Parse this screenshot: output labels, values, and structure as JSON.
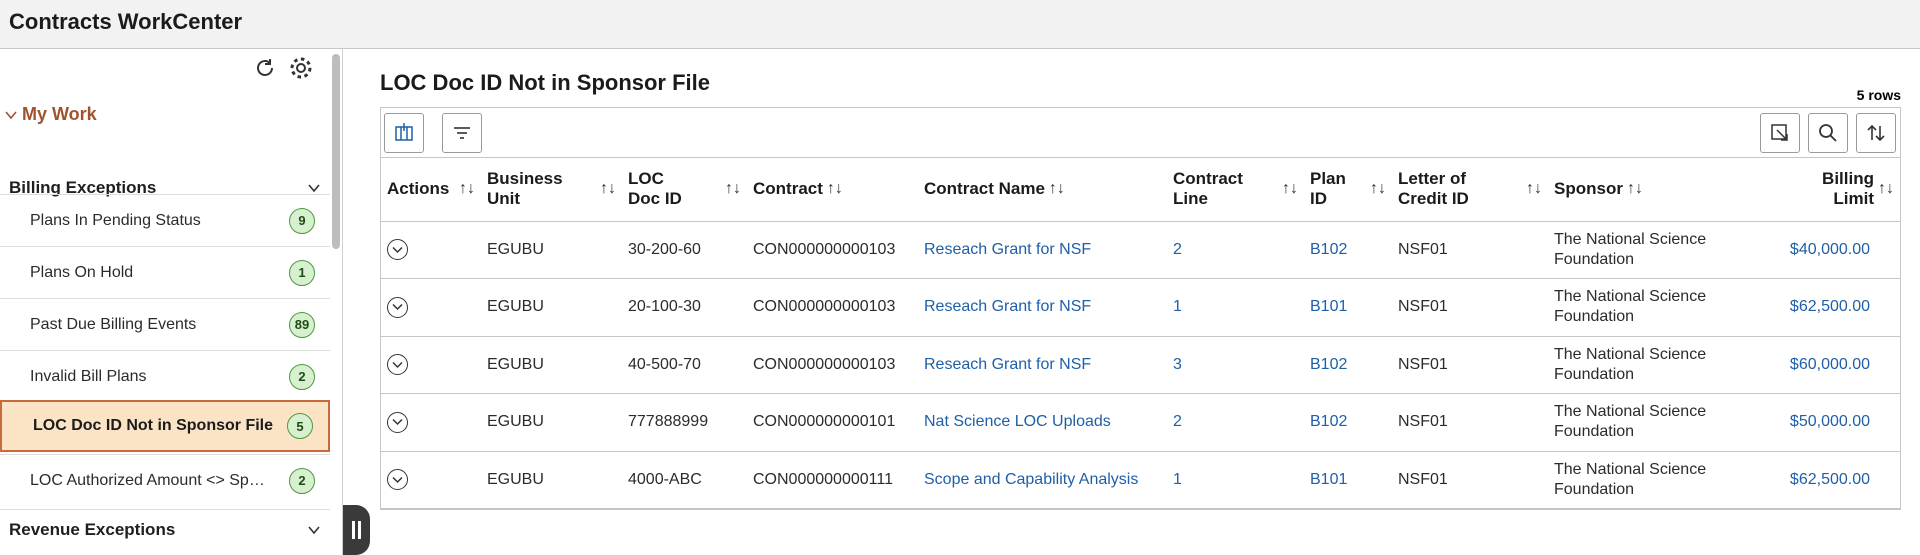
{
  "app": {
    "title": "Contracts WorkCenter"
  },
  "sidebar": {
    "my_work_label": "My Work",
    "groups": [
      {
        "label": "Billing Exceptions",
        "items": [
          {
            "label": "Plans In Pending Status",
            "count": "9"
          },
          {
            "label": "Plans On Hold",
            "count": "1"
          },
          {
            "label": "Past Due Billing Events",
            "count": "89"
          },
          {
            "label": "Invalid Bill Plans",
            "count": "2"
          },
          {
            "label": "LOC Doc ID Not in Sponsor File",
            "count": "5",
            "selected": true
          },
          {
            "label": "LOC Authorized Amount <> Sponsor",
            "count": "2"
          }
        ]
      },
      {
        "label": "Revenue Exceptions"
      }
    ]
  },
  "main": {
    "title": "LOC Doc ID Not in Sponsor File",
    "row_count": "5 rows",
    "columns": [
      "Actions",
      "Business Unit",
      "LOC Doc ID",
      "Contract",
      "Contract Name",
      "Contract Line",
      "Plan ID",
      "Letter of Credit ID",
      "Sponsor",
      "Billing Limit"
    ],
    "rows": [
      {
        "bu": "EGUBU",
        "loc": "30-200-60",
        "contract": "CON000000000103",
        "name": "Reseach Grant for NSF",
        "line": "2",
        "plan": "B102",
        "lcid": "NSF01",
        "sponsor": "The National Science Foundation",
        "limit": "$40,000.00"
      },
      {
        "bu": "EGUBU",
        "loc": "20-100-30",
        "contract": "CON000000000103",
        "name": "Reseach Grant for NSF",
        "line": "1",
        "plan": "B101",
        "lcid": "NSF01",
        "sponsor": "The National Science Foundation",
        "limit": "$62,500.00"
      },
      {
        "bu": "EGUBU",
        "loc": "40-500-70",
        "contract": "CON000000000103",
        "name": "Reseach Grant for NSF",
        "line": "3",
        "plan": "B102",
        "lcid": "NSF01",
        "sponsor": "The National Science Foundation",
        "limit": "$60,000.00"
      },
      {
        "bu": "EGUBU",
        "loc": "777888999",
        "contract": "CON000000000101",
        "name": "Nat Science LOC Uploads",
        "line": "2",
        "plan": "B102",
        "lcid": "NSF01",
        "sponsor": "The National Science Foundation",
        "limit": "$50,000.00"
      },
      {
        "bu": "EGUBU",
        "loc": "4000-ABC",
        "contract": "CON000000000111",
        "name": "Scope and Capability Analysis",
        "line": "1",
        "plan": "B101",
        "lcid": "NSF01",
        "sponsor": "The National Science Foundation",
        "limit": "$62,500.00"
      }
    ]
  },
  "icons": {
    "refresh": "refresh-icon",
    "settings": "gear-icon",
    "columns": "column-chooser-icon",
    "filter": "filter-icon",
    "export": "export-icon",
    "search": "search-icon",
    "sort": "sort-icon",
    "sort_glyph": "↑↓"
  },
  "colors": {
    "link": "#1e5fa8",
    "accent": "#a0522d",
    "selected_bg": "#fbe3c6",
    "badge_bg": "#d7f0cf"
  }
}
